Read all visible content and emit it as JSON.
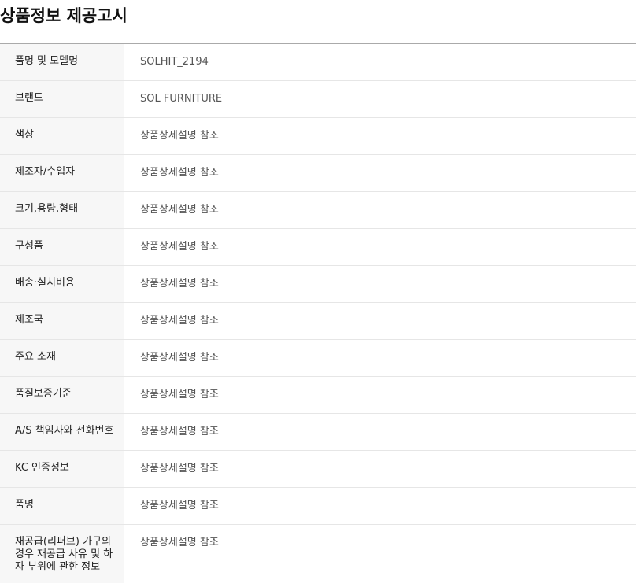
{
  "page_title": "상품정보 제공고시",
  "rows": [
    {
      "label": "품명 및 모델명",
      "value": "SOLHIT_2194"
    },
    {
      "label": "브랜드",
      "value": "SOL FURNITURE"
    },
    {
      "label": "색상",
      "value": "상품상세설명 참조"
    },
    {
      "label": "제조자/수입자",
      "value": "상품상세설명 참조"
    },
    {
      "label": "크기,용량,형태",
      "value": "상품상세설명 참조"
    },
    {
      "label": "구성품",
      "value": "상품상세설명 참조"
    },
    {
      "label": "배송·설치비용",
      "value": "상품상세설명 참조"
    },
    {
      "label": "제조국",
      "value": "상품상세설명 참조"
    },
    {
      "label": "주요 소재",
      "value": "상품상세설명 참조"
    },
    {
      "label": "품질보증기준",
      "value": "상품상세설명 참조"
    },
    {
      "label": "A/S 책임자와 전화번호",
      "value": "상품상세설명 참조"
    },
    {
      "label": "KC 인증정보",
      "value": "상품상세설명 참조"
    },
    {
      "label": "품명",
      "value": "상품상세설명 참조"
    },
    {
      "label": "재공급(리퍼브) 가구의 경우 재공급 사유 및 하자 부위에 관한 정보",
      "value": "상품상세설명 참조"
    }
  ]
}
